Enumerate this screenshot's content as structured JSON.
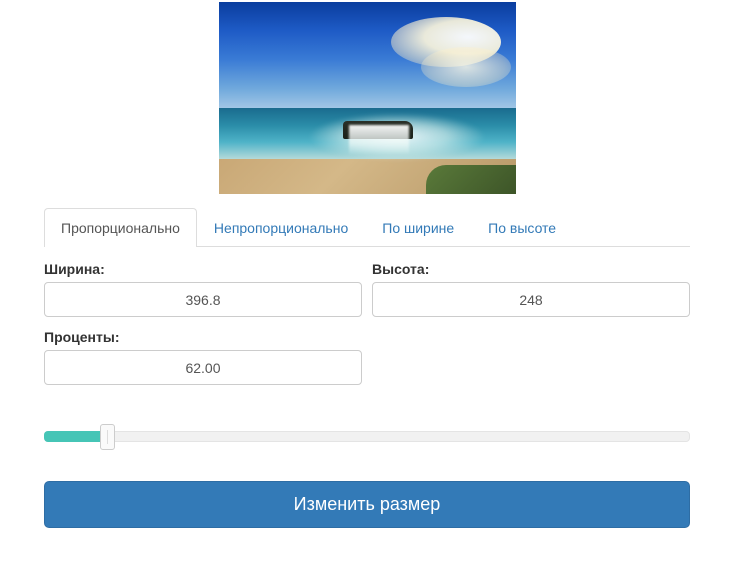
{
  "tabs": {
    "proportional": "Пропорционально",
    "nonproportional": "Непропорционально",
    "by_width": "По ширине",
    "by_height": "По высоте"
  },
  "form": {
    "width_label": "Ширина:",
    "width_value": "396.8",
    "height_label": "Высота:",
    "height_value": "248",
    "percent_label": "Проценты:",
    "percent_value": "62.00"
  },
  "slider": {
    "value": 62,
    "min": 0,
    "max": 600
  },
  "submit_label": "Изменить размер"
}
